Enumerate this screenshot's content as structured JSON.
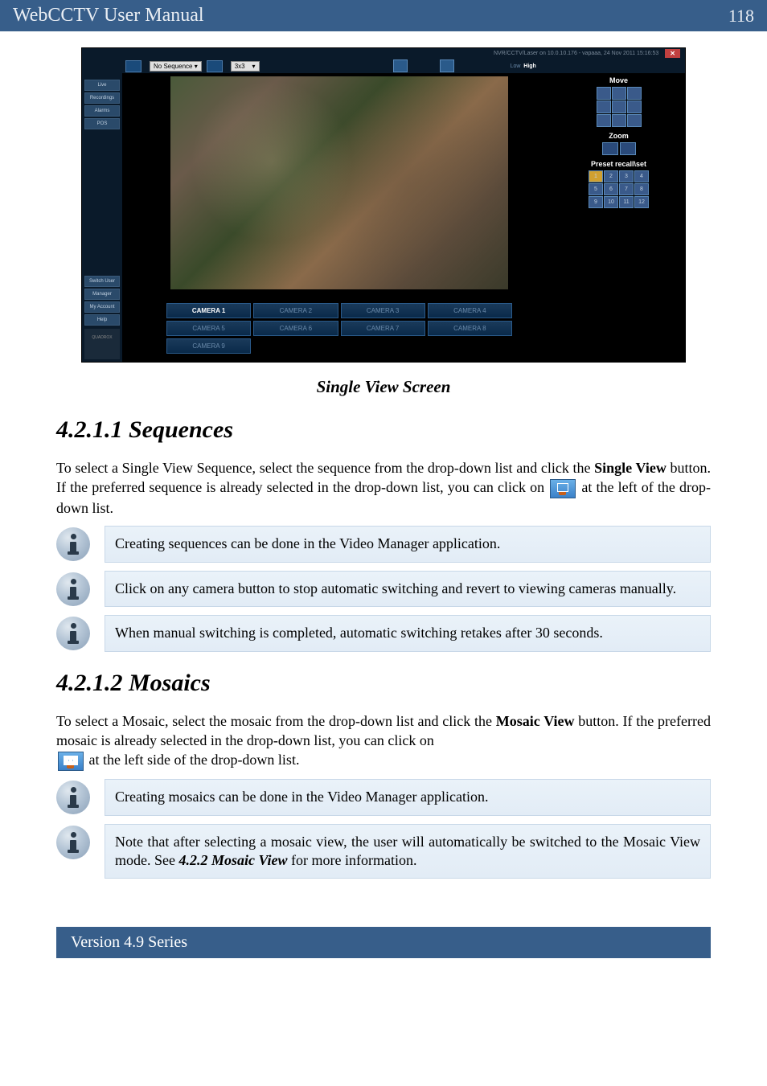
{
  "header": {
    "title": "WebCCTV User Manual",
    "page": "118"
  },
  "screenshot": {
    "titlebar": "NVR/CCTV/Laser on 10.0.10.176 - vapaaa, 24 Nov 2011 15:16:53",
    "sequence_dd": "No Sequence",
    "mosaic_dd": "3x3",
    "speed_low": "Low",
    "speed_high": "High",
    "sidebar": [
      "Live",
      "Recordings",
      "Alarms",
      "POS",
      "Switch User",
      "Manager",
      "My Account",
      "Help"
    ],
    "sidebar_footer": "QUADROX",
    "ptz": {
      "move": "Move",
      "zoom": "Zoom",
      "preset": "Preset recall\\set"
    },
    "presets": [
      "1",
      "2",
      "3",
      "4",
      "5",
      "6",
      "7",
      "8",
      "9",
      "10",
      "11",
      "12"
    ],
    "cameras": [
      "CAMERA 1",
      "CAMERA 2",
      "CAMERA 3",
      "CAMERA 4",
      "CAMERA 5",
      "CAMERA 6",
      "CAMERA 7",
      "CAMERA 8",
      "CAMERA 9"
    ]
  },
  "caption": "Single View Screen",
  "sec1_h": "4.2.1.1 Sequences",
  "sec1_p1a": "To select a Single View Sequence, select the sequence from the drop-down list and click the ",
  "sec1_p1b": "Single View",
  "sec1_p1c": " button. If the preferred sequence is already selected in the drop-down list, you can click on ",
  "sec1_p1d": " at the left of the drop-down list.",
  "note1": "Creating sequences can be done in the Video Manager application.",
  "note2": "Click on any camera button to stop automatic switching and revert to viewing cameras manually.",
  "note3": "When manual switching is completed, automatic switching retakes after 30 seconds.",
  "sec2_h": "4.2.1.2 Mosaics",
  "sec2_p1a": "To select a Mosaic, select the mosaic from the drop-down list and click the ",
  "sec2_p1b": "Mosaic View",
  "sec2_p1c": " button. If the preferred mosaic is already selected in the drop-down list, you can click on ",
  "sec2_p1d": " at the left side of the drop-down list.",
  "note4": "Creating mosaics can be done in the Video Manager application.",
  "note5a": "Note that after selecting a mosaic view, the user will automatically be switched to the Mosaic View mode. See ",
  "note5b": "4.2.2 Mosaic View",
  "note5c": " for more information.",
  "footer": "Version 4.9 Series"
}
